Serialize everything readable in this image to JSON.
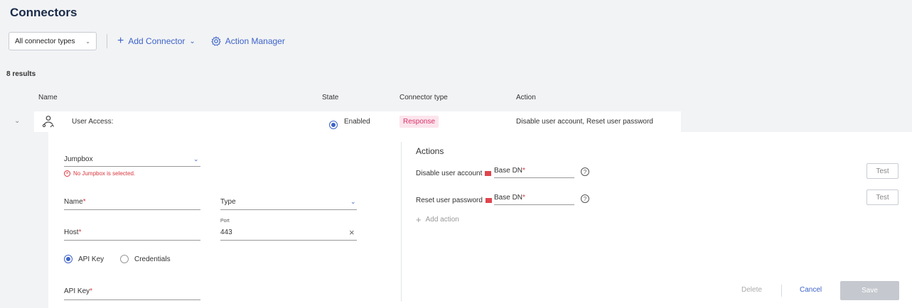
{
  "page": {
    "title": "Connectors"
  },
  "toolbar": {
    "filter_value": "All connector types",
    "add_connector": "Add Connector",
    "action_manager": "Action Manager"
  },
  "results": {
    "count_label": "8 results"
  },
  "table": {
    "headers": {
      "name": "Name",
      "state": "State",
      "type": "Connector type",
      "action": "Action"
    },
    "row": {
      "name": "User Access:",
      "state": "Enabled",
      "type": "Response",
      "action": "Disable user account, Reset user password"
    }
  },
  "form": {
    "jumpbox_label": "Jumpbox",
    "jumpbox_error": "No Jumpbox is selected.",
    "name_label": "Name",
    "type_label": "Type",
    "host_label": "Host",
    "port_label": "Port",
    "port_value": "443",
    "auth_api_key": "API Key",
    "auth_credentials": "Credentials",
    "api_key_label": "API Key",
    "required_mark": "*"
  },
  "actions": {
    "title": "Actions",
    "items": [
      {
        "label": "Disable user account",
        "field_label": "Base DN",
        "test_label": "Test"
      },
      {
        "label": "Reset user password",
        "field_label": "Base DN",
        "test_label": "Test"
      }
    ],
    "add_action": "Add action"
  },
  "footer": {
    "delete": "Delete",
    "cancel": "Cancel",
    "save": "Save"
  },
  "colors": {
    "accent": "#3d63c8",
    "error": "#d9363e",
    "badge_bg": "#fce4ec",
    "badge_text": "#d6336c"
  }
}
